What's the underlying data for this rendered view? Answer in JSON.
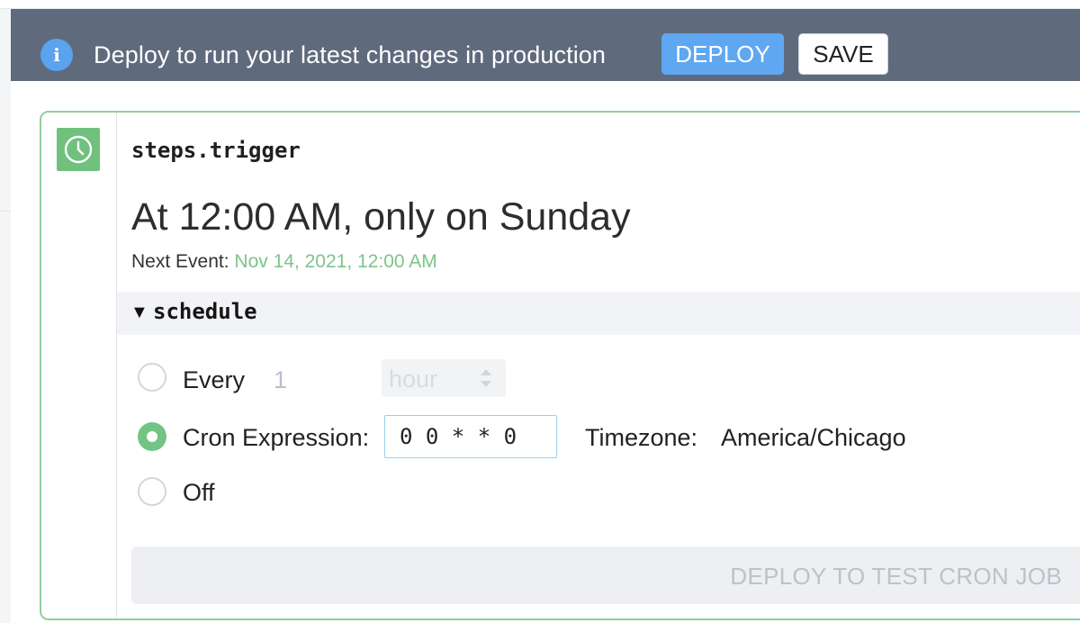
{
  "banner": {
    "message": "Deploy to run your latest changes in production",
    "deploy_label": "DEPLOY",
    "save_label": "SAVE",
    "icon": "info-icon"
  },
  "step": {
    "name": "steps.trigger",
    "icon": "clock-icon",
    "schedule_summary": "At 12:00 AM, only on Sunday",
    "next_event_label": "Next Event:",
    "next_event_value": "Nov 14, 2021, 12:00 AM"
  },
  "schedule": {
    "section_title": "schedule",
    "options": {
      "every": {
        "label": "Every",
        "value": "1",
        "unit": "hour",
        "selected": false
      },
      "cron": {
        "label": "Cron Expression:",
        "value": "0 0 * * 0",
        "selected": true
      },
      "off": {
        "label": "Off",
        "selected": false
      }
    },
    "timezone_label": "Timezone:",
    "timezone_value": "America/Chicago"
  },
  "test_button_label": "DEPLOY TO TEST CRON JOB",
  "colors": {
    "banner_bg": "#5f6a7d",
    "accent_blue": "#60a7f2",
    "accent_green": "#72c485",
    "card_border": "#8fd09a"
  }
}
